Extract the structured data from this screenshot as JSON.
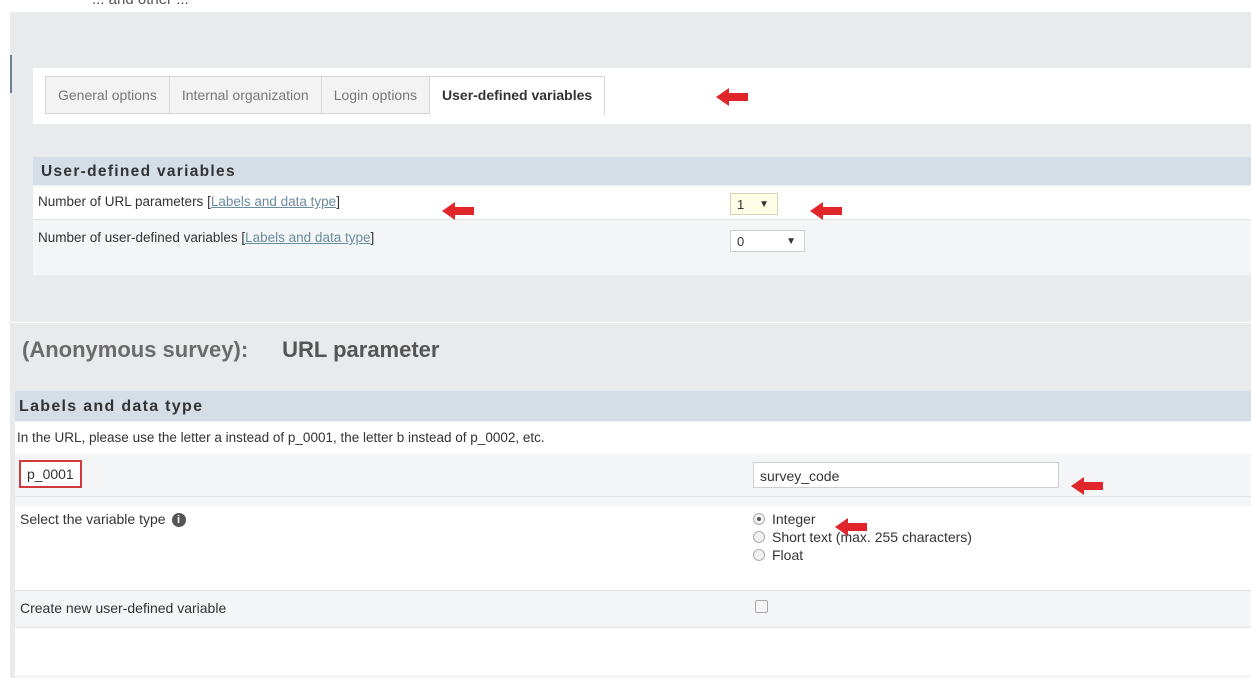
{
  "top_text": "... and other ...",
  "tabs": [
    {
      "label": "General options"
    },
    {
      "label": "Internal organization"
    },
    {
      "label": "Login options"
    },
    {
      "label": "User-defined variables"
    }
  ],
  "section1": {
    "title": "User-defined variables",
    "rows": [
      {
        "label": "Number of URL parameters",
        "link": "Labels and data type",
        "value": "1"
      },
      {
        "label": "Number of user-defined variables",
        "link": "Labels and data type",
        "value": "0"
      }
    ]
  },
  "section2": {
    "title_left": "(Anonymous survey):",
    "title_right": "URL parameter",
    "header": "Labels and data type",
    "note": "In the URL, please use the letter a instead of p_0001, the letter b instead of p_0002, etc.",
    "variable_name": "p_0001",
    "variable_label": "survey_code",
    "type_label": "Select the variable type",
    "info_icon": "i",
    "types": [
      {
        "label": "Integer",
        "checked": true
      },
      {
        "label": "Short text (max. 255 characters)",
        "checked": false
      },
      {
        "label": "Float",
        "checked": false
      }
    ],
    "new_variable_label": "Create new user-defined variable",
    "new_variable_checked": false
  },
  "colors": {
    "arrow": "#e0262a",
    "highlight_box": "#d03a3a",
    "header_band": "#d5dde7",
    "link": "#6b8c9e"
  },
  "icons": {
    "annotation": "red-arrow-icon",
    "info": "info-icon",
    "dropdown": "caret-down-icon"
  }
}
